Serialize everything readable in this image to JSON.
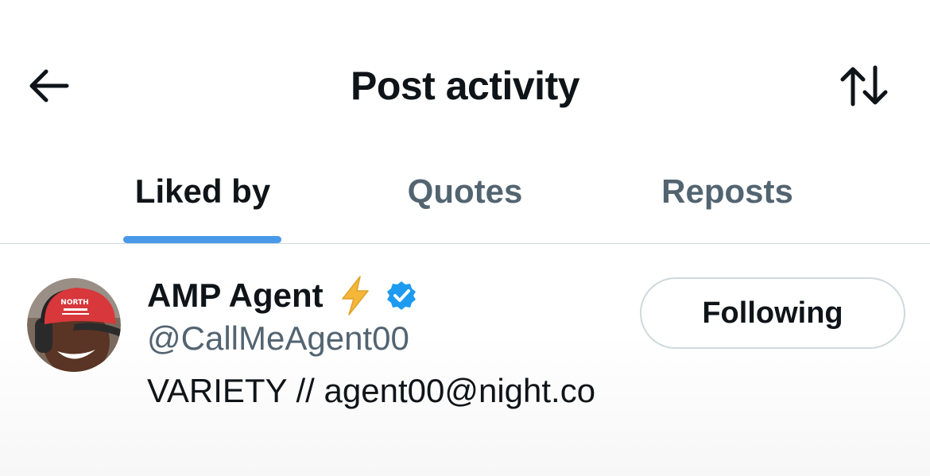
{
  "header": {
    "title": "Post activity",
    "back_icon": "arrow-left-icon",
    "sort_icon": "sort-arrows-icon"
  },
  "tabs": [
    {
      "label": "Liked by",
      "active": true
    },
    {
      "label": "Quotes",
      "active": false
    },
    {
      "label": "Reposts",
      "active": false
    }
  ],
  "user": {
    "display_name": "AMP Agent",
    "name_emoji_icon": "lightning-bolt-icon",
    "verified_icon": "verified-badge-icon",
    "handle": "@CallMeAgent00",
    "bio": "VARIETY // agent00@night.co",
    "follow_button_label": "Following",
    "avatar_icon": "avatar"
  },
  "colors": {
    "accent": "#4a99e9",
    "text_primary": "#0f1419",
    "text_secondary": "#536471",
    "border": "#cfd9de",
    "bolt": "#f4b73a",
    "verified": "#1d9bf0"
  }
}
